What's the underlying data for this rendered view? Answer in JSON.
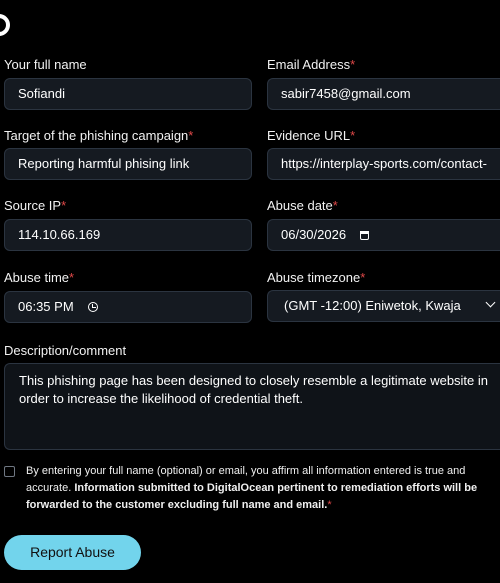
{
  "form": {
    "full_name": {
      "label": "Your full name",
      "value": "Sofiandi"
    },
    "email": {
      "label": "Email Address",
      "required": "*",
      "value": "sabir7458@gmail.com"
    },
    "target": {
      "label": "Target of the phishing campaign",
      "required": "*",
      "value": "Reporting harmful phising link"
    },
    "evidence_url": {
      "label": "Evidence URL",
      "required": "*",
      "value": "https://interplay-sports.com/contact-"
    },
    "source_ip": {
      "label": "Source IP",
      "required": "*",
      "value": "114.10.66.169"
    },
    "abuse_date": {
      "label": "Abuse date",
      "required": "*",
      "value": "06/30/2026"
    },
    "abuse_time": {
      "label": "Abuse time",
      "required": "*",
      "value": "06:35 PM"
    },
    "abuse_timezone": {
      "label": "Abuse timezone",
      "required": "*",
      "value": "(GMT -12:00) Eniwetok, Kwaja"
    },
    "description": {
      "label": "Description/comment",
      "value": "This phishing page has been designed to closely resemble a legitimate website in order to increase the likelihood of credential theft."
    },
    "consent": {
      "checked": false,
      "text_plain": "By entering your full name (optional) or email, you affirm all information entered is true and accurate. ",
      "text_bold": "Information submitted to DigitalOcean pertinent to remediation efforts will be forwarded to the customer excluding full name and email.",
      "required": "*"
    },
    "submit_label": "Report Abuse"
  },
  "icons": {
    "logo": "logo-ring",
    "date": "calendar-icon",
    "time": "clock-icon",
    "select": "chevron-down-icon"
  },
  "colors": {
    "background": "#000000",
    "field_bg": "#151a21",
    "field_border": "#2b3440",
    "required": "#e04848",
    "button": "#72d4ec"
  }
}
